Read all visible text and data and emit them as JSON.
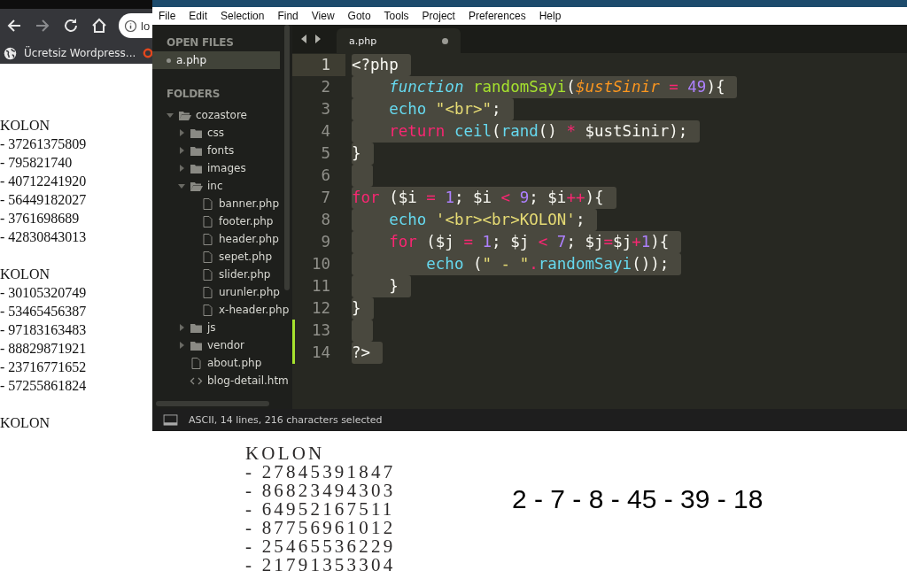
{
  "browser": {
    "address": "lo",
    "bookmarks": [
      {
        "label": "Ücretsiz Wordpress..."
      }
    ]
  },
  "page_output": [
    {
      "heading": "KOLON",
      "lines": [
        "- 37261375809",
        "- 795821740",
        "- 40712241920",
        "- 56449182027",
        "- 3761698689",
        "- 42830843013"
      ]
    },
    {
      "heading": "KOLON",
      "lines": [
        "- 30105320749",
        "- 53465456387",
        "- 97183163483",
        "- 88829871921",
        "- 23716771652",
        "- 57255861824"
      ]
    },
    {
      "heading": "KOLON"
    }
  ],
  "editor": {
    "menu": [
      "File",
      "Edit",
      "Selection",
      "Find",
      "View",
      "Goto",
      "Tools",
      "Project",
      "Preferences",
      "Help"
    ],
    "sidebar": {
      "open_files_title": "OPEN FILES",
      "open_files": [
        {
          "name": "a.php",
          "selected": true
        }
      ],
      "folders_title": "FOLDERS",
      "tree": [
        {
          "name": "cozastore",
          "kind": "folder",
          "expanded": true,
          "children": [
            {
              "name": "css",
              "kind": "folder",
              "expanded": false
            },
            {
              "name": "fonts",
              "kind": "folder",
              "expanded": false
            },
            {
              "name": "images",
              "kind": "folder",
              "expanded": false
            },
            {
              "name": "inc",
              "kind": "folder",
              "expanded": true,
              "children": [
                {
                  "name": "banner.php",
                  "kind": "file"
                },
                {
                  "name": "footer.php",
                  "kind": "file"
                },
                {
                  "name": "header.php",
                  "kind": "file"
                },
                {
                  "name": "sepet.php",
                  "kind": "file"
                },
                {
                  "name": "slider.php",
                  "kind": "file"
                },
                {
                  "name": "urunler.php",
                  "kind": "file"
                },
                {
                  "name": "x-header.php",
                  "kind": "file"
                }
              ]
            },
            {
              "name": "js",
              "kind": "folder",
              "expanded": false
            },
            {
              "name": "vendor",
              "kind": "folder",
              "expanded": false
            },
            {
              "name": "about.php",
              "kind": "file"
            },
            {
              "name": "blog-detail.htm",
              "kind": "markup"
            }
          ]
        }
      ]
    },
    "tab": {
      "label": "a.php",
      "modified": true
    },
    "lines": [
      {
        "number": "1",
        "current": true,
        "modified": false,
        "tokens": [
          {
            "text": "<?php",
            "kind": "plain"
          }
        ]
      },
      {
        "number": "2",
        "current": false,
        "modified": false,
        "tokens": [
          {
            "text": "\tfunction ",
            "kind": "storage"
          },
          {
            "text": "randomSayi",
            "kind": "func"
          },
          {
            "text": "(",
            "kind": "plain"
          },
          {
            "text": "$ustSinir ",
            "kind": "param"
          },
          {
            "text": "= ",
            "kind": "op"
          },
          {
            "text": "49",
            "kind": "num"
          },
          {
            "text": "){",
            "kind": "plain"
          }
        ]
      },
      {
        "number": "3",
        "current": false,
        "modified": false,
        "tokens": [
          {
            "text": "\techo ",
            "kind": "support"
          },
          {
            "text": "\"<br>\"",
            "kind": "string"
          },
          {
            "text": ";",
            "kind": "plain"
          }
        ]
      },
      {
        "number": "4",
        "current": false,
        "modified": false,
        "tokens": [
          {
            "text": "\treturn ",
            "kind": "op"
          },
          {
            "text": "ceil",
            "kind": "support"
          },
          {
            "text": "(",
            "kind": "plain"
          },
          {
            "text": "rand",
            "kind": "support"
          },
          {
            "text": "() ",
            "kind": "plain"
          },
          {
            "text": "*",
            "kind": "op"
          },
          {
            "text": " $ustSinir);",
            "kind": "plain"
          }
        ]
      },
      {
        "number": "5",
        "current": false,
        "modified": false,
        "tokens": [
          {
            "text": "}",
            "kind": "plain"
          }
        ]
      },
      {
        "number": "6",
        "current": false,
        "modified": false
      },
      {
        "number": "7",
        "current": false,
        "modified": false,
        "tokens": [
          {
            "text": "for",
            "kind": "op"
          },
          {
            "text": " ($i ",
            "kind": "plain"
          },
          {
            "text": "= ",
            "kind": "op"
          },
          {
            "text": "1",
            "kind": "num"
          },
          {
            "text": "; $i ",
            "kind": "plain"
          },
          {
            "text": "< ",
            "kind": "op"
          },
          {
            "text": "9",
            "kind": "num"
          },
          {
            "text": "; $i",
            "kind": "plain"
          },
          {
            "text": "++",
            "kind": "op"
          },
          {
            "text": "){",
            "kind": "plain"
          }
        ]
      },
      {
        "number": "8",
        "current": false,
        "modified": false,
        "tokens": [
          {
            "text": "\techo ",
            "kind": "support"
          },
          {
            "text": "'<br><br>KOLON'",
            "kind": "string"
          },
          {
            "text": ";",
            "kind": "plain"
          }
        ]
      },
      {
        "number": "9",
        "current": false,
        "modified": false,
        "tokens": [
          {
            "text": "\tfor",
            "kind": "op"
          },
          {
            "text": " ($j ",
            "kind": "plain"
          },
          {
            "text": "= ",
            "kind": "op"
          },
          {
            "text": "1",
            "kind": "num"
          },
          {
            "text": "; $j ",
            "kind": "plain"
          },
          {
            "text": "< ",
            "kind": "op"
          },
          {
            "text": "7",
            "kind": "num"
          },
          {
            "text": "; $j",
            "kind": "plain"
          },
          {
            "text": "=",
            "kind": "op"
          },
          {
            "text": "$j",
            "kind": "plain"
          },
          {
            "text": "+",
            "kind": "op"
          },
          {
            "text": "1",
            "kind": "num"
          },
          {
            "text": "){",
            "kind": "plain"
          }
        ]
      },
      {
        "number": "10",
        "current": false,
        "modified": false,
        "tokens": [
          {
            "text": "\t\techo ",
            "kind": "support"
          },
          {
            "text": "(",
            "kind": "plain"
          },
          {
            "text": "\" - \"",
            "kind": "string"
          },
          {
            "text": ".",
            "kind": "op"
          },
          {
            "text": "randomSayi",
            "kind": "support"
          },
          {
            "text": "());",
            "kind": "plain"
          }
        ]
      },
      {
        "number": "11",
        "current": false,
        "modified": false,
        "tokens": [
          {
            "text": "\t}",
            "kind": "plain"
          }
        ]
      },
      {
        "number": "12",
        "current": false,
        "modified": false,
        "tokens": [
          {
            "text": "}",
            "kind": "plain"
          }
        ]
      },
      {
        "number": "13",
        "current": false,
        "modified": true
      },
      {
        "number": "14",
        "current": false,
        "modified": true,
        "tokens": [
          {
            "text": "?>",
            "kind": "plain"
          }
        ]
      }
    ],
    "status": "ASCII, 14 lines, 216 characters selected"
  },
  "stretched_output": {
    "heading": "KOLON",
    "lines": [
      "- 27845391847",
      "- 86823494303",
      "- 64952167511",
      "- 87756961012",
      "- 25465536229",
      "- 21791353304"
    ]
  },
  "lottery_numbers": "2 - 7 - 8 - 45 - 39 - 18"
}
